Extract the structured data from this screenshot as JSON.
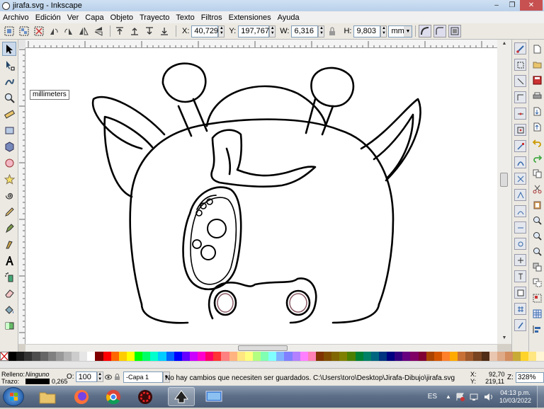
{
  "window": {
    "title": "jirafa.svg - Inkscape",
    "controls": [
      "‒",
      "❐",
      "✕"
    ]
  },
  "menubar": {
    "items": [
      "Archivo",
      "Edición",
      "Ver",
      "Capa",
      "Objeto",
      "Trayecto",
      "Texto",
      "Filtros",
      "Extensiones",
      "Ayuda"
    ]
  },
  "tool_controls": {
    "x_label": "X:",
    "x_value": "40,729",
    "y_label": "Y:",
    "y_value": "197,767",
    "w_label": "W:",
    "w_value": "6,316",
    "h_label": "H:",
    "h_value": "9,803",
    "unit": "mm"
  },
  "toolbox": {
    "tools": [
      "selector-tool",
      "node-tool",
      "tweak-tool",
      "zoom-tool",
      "measure-tool",
      "rectangle-tool",
      "3d-box-tool",
      "ellipse-tool",
      "star-tool",
      "spiral-tool",
      "pencil-tool",
      "pen-tool",
      "calligraphy-tool",
      "text-tool",
      "spray-tool",
      "eraser-tool",
      "paint-bucket-tool",
      "gradient-tool"
    ],
    "active": "selector-tool"
  },
  "tooltip": {
    "text": "millimeters"
  },
  "palette": {
    "colors": [
      "#000000",
      "#1a1a1a",
      "#333333",
      "#4d4d4d",
      "#666666",
      "#808080",
      "#999999",
      "#b3b3b3",
      "#cccccc",
      "#e6e6e6",
      "#ffffff",
      "#800000",
      "#ff0000",
      "#ff6600",
      "#ffcc00",
      "#ffff00",
      "#00ff00",
      "#00ff66",
      "#00ffcc",
      "#00ccff",
      "#0066ff",
      "#0000ff",
      "#6600ff",
      "#cc00ff",
      "#ff00cc",
      "#ff0066",
      "#ff3333",
      "#ff8080",
      "#ffb380",
      "#ffe680",
      "#ffff80",
      "#b3ff80",
      "#80ffb3",
      "#80ffff",
      "#80b3ff",
      "#8080ff",
      "#b380ff",
      "#ff80ff",
      "#ff80b3",
      "#803300",
      "#804d00",
      "#806600",
      "#808000",
      "#4d8000",
      "#008033",
      "#008066",
      "#006680",
      "#003380",
      "#000080",
      "#330080",
      "#660080",
      "#800066",
      "#800033",
      "#aa4400",
      "#d45500",
      "#ff7f2a",
      "#ffaa00",
      "#c87137",
      "#a05a2c",
      "#784421",
      "#502d16",
      "#e9c6af",
      "#deaa87",
      "#d38d5f",
      "#c8ab37",
      "#ffd42a",
      "#ffe680",
      "#fff6d5"
    ]
  },
  "statusbar": {
    "fill_label": "Relleno:",
    "fill_value": "Ninguno",
    "stroke_label": "Trazo:",
    "stroke_value": "0,265",
    "opacity_label": "O:",
    "opacity_value": "100",
    "layer_value": "-Capa 1",
    "message": "No hay cambios que necesiten ser guardados. C:\\Users\\toro\\Desktop\\Jirafa-Dibujo\\jirafa.svg",
    "x_label": "X:",
    "x_value": "92,70",
    "y_label": "Y:",
    "y_value": "219,11",
    "zoom_label": "Z:",
    "zoom_value": "328%"
  },
  "taskbar": {
    "apps": [
      "file-explorer",
      "firefox",
      "chrome",
      "app-red-gear",
      "inkscape",
      "screen-capture"
    ],
    "active_app": "inkscape",
    "language": "ES",
    "time": "04:13 p.m.",
    "date": "10/03/2022"
  }
}
